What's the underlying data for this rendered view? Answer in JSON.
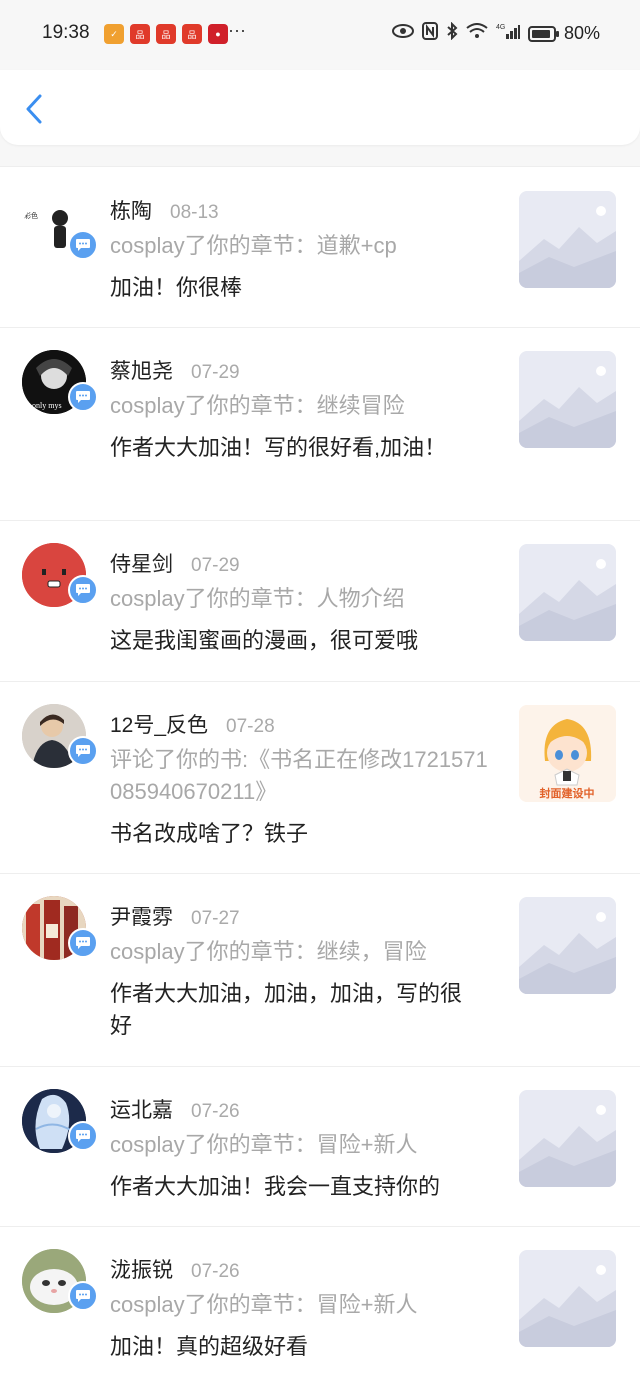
{
  "status_bar": {
    "time": "19:38",
    "more": "···",
    "battery": "80%",
    "network_label": "4G"
  },
  "header": {
    "back_icon": "chevron-left-icon"
  },
  "notifications": [
    {
      "name": "栋陶",
      "date": "08-13",
      "action": "cosplay了你的章节：道歉+cp",
      "comment": "加油！你很棒",
      "thumb": "placeholder"
    },
    {
      "name": "蔡旭尧",
      "date": "07-29",
      "action": "cosplay了你的章节：继续冒险",
      "comment": "作者大大加油！写的很好看,加油！",
      "thumb": "placeholder"
    },
    {
      "name": "侍星剑",
      "date": "07-29",
      "action": "cosplay了你的章节：人物介绍",
      "comment": "这是我闺蜜画的漫画，很可爱哦",
      "thumb": "placeholder"
    },
    {
      "name": "12号_反色",
      "date": "07-28",
      "action": "评论了你的书:《书名正在修改1721571085940670211》",
      "comment": "书名改成啥了？铁子",
      "thumb": "cover",
      "thumb_caption": "封面建设中"
    },
    {
      "name": "尹霞雰",
      "date": "07-27",
      "action": "cosplay了你的章节：继续，冒险",
      "comment": "作者大大加油，加油，加油，写的很好",
      "thumb": "placeholder"
    },
    {
      "name": "运北嘉",
      "date": "07-26",
      "action": "cosplay了你的章节：冒险+新人",
      "comment": "作者大大加油！我会一直支持你的",
      "thumb": "placeholder"
    },
    {
      "name": "泷振锐",
      "date": "07-26",
      "action": "cosplay了你的章节：冒险+新人",
      "comment": "加油！真的超级好看",
      "thumb": "placeholder"
    }
  ]
}
